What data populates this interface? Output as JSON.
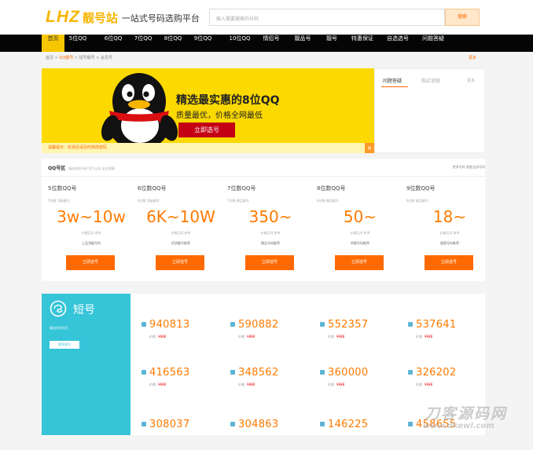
{
  "header": {
    "logo_text": "LHZ",
    "site_name": "靓号站",
    "tagline": "一站式号码选购平台",
    "search_placeholder": "输入需要搜索的号码",
    "search_button": "搜索"
  },
  "nav": {
    "items": [
      "首页",
      "5位QQ",
      "6位QQ",
      "7位QQ",
      "8位QQ",
      "9位QQ",
      "10位QQ",
      "情侣号",
      "靓品号",
      "靓号",
      "特惠保证",
      "自选选号",
      "问题答疑"
    ]
  },
  "breadcrumb": {
    "home": "首页",
    "current": "QQ靓号",
    "trail": "> 短号靓号 > 会员号",
    "right": "更多"
  },
  "banner": {
    "title": "精选最实惠的8位QQ",
    "subtitle": "质量最优，价格全网最低",
    "button": "立即选号",
    "notice": "温馨提示：收货后请及时修改密码",
    "notice_close": "×"
  },
  "side": {
    "tab_active": "问题答疑",
    "tab_other": "购买流程",
    "more": "更多"
  },
  "qq_section": {
    "title": "QQ号区",
    "desc": "精选优质号码 官方认证 安全保障",
    "right": "更多号码 查看全部号码",
    "columns": [
      {
        "name": "5位数QQ号",
        "desc": "5位数 顶级靓号",
        "price": "3w~10w",
        "sub": "价格区间 参考",
        "sub2": "上品顶级号码",
        "button": "立即选号"
      },
      {
        "name": "6位数QQ号",
        "desc": "6位数 顶级靓号",
        "price": "6K~10W",
        "sub": "价格区间 参考",
        "sub2": "优质靓号推荐",
        "button": "立即选号"
      },
      {
        "name": "7位数QQ号",
        "desc": "7位数 精品靓号",
        "price": "350~",
        "sub": "价格区间 参考",
        "sub2": "精品号码推荐",
        "button": "立即选号"
      },
      {
        "name": "8位数QQ号",
        "desc": "8位数 精品靓号",
        "price": "50~",
        "sub": "价格区间 参考",
        "sub2": "特惠号码推荐",
        "button": "立即选号"
      },
      {
        "name": "9位数QQ号",
        "desc": "9位数 精品靓号",
        "price": "18~",
        "sub": "价格区间 参考",
        "sub2": "超值号码推荐",
        "button": "立即选号"
      }
    ]
  },
  "short": {
    "title": "短号",
    "desc": "精选优质短号",
    "button": "更多短号",
    "items": [
      {
        "num": "940813",
        "tag": "Q",
        "sub": "价格",
        "price": "¥888"
      },
      {
        "num": "590882",
        "tag": "Q",
        "sub": "价格",
        "price": "¥888"
      },
      {
        "num": "552357",
        "tag": "Q",
        "sub": "价格",
        "price": "¥888"
      },
      {
        "num": "537641",
        "tag": "Q",
        "sub": "价格",
        "price": "¥888"
      },
      {
        "num": "416563",
        "tag": "Q",
        "sub": "价格",
        "price": "¥888"
      },
      {
        "num": "348562",
        "tag": "Q",
        "sub": "价格",
        "price": "¥888"
      },
      {
        "num": "360000",
        "tag": "Q",
        "sub": "价格",
        "price": "¥888"
      },
      {
        "num": "326202",
        "tag": "Q",
        "sub": "价格",
        "price": "¥888"
      },
      {
        "num": "308037",
        "tag": "Q",
        "sub": "",
        "price": ""
      },
      {
        "num": "304863",
        "tag": "Q",
        "sub": "",
        "price": ""
      },
      {
        "num": "146225",
        "tag": "Q",
        "sub": "",
        "price": ""
      },
      {
        "num": "458655",
        "tag": "Q",
        "sub": "",
        "price": ""
      }
    ]
  },
  "watermark": {
    "line1": "刀客源码网",
    "line2": "www.dkewl.com"
  }
}
